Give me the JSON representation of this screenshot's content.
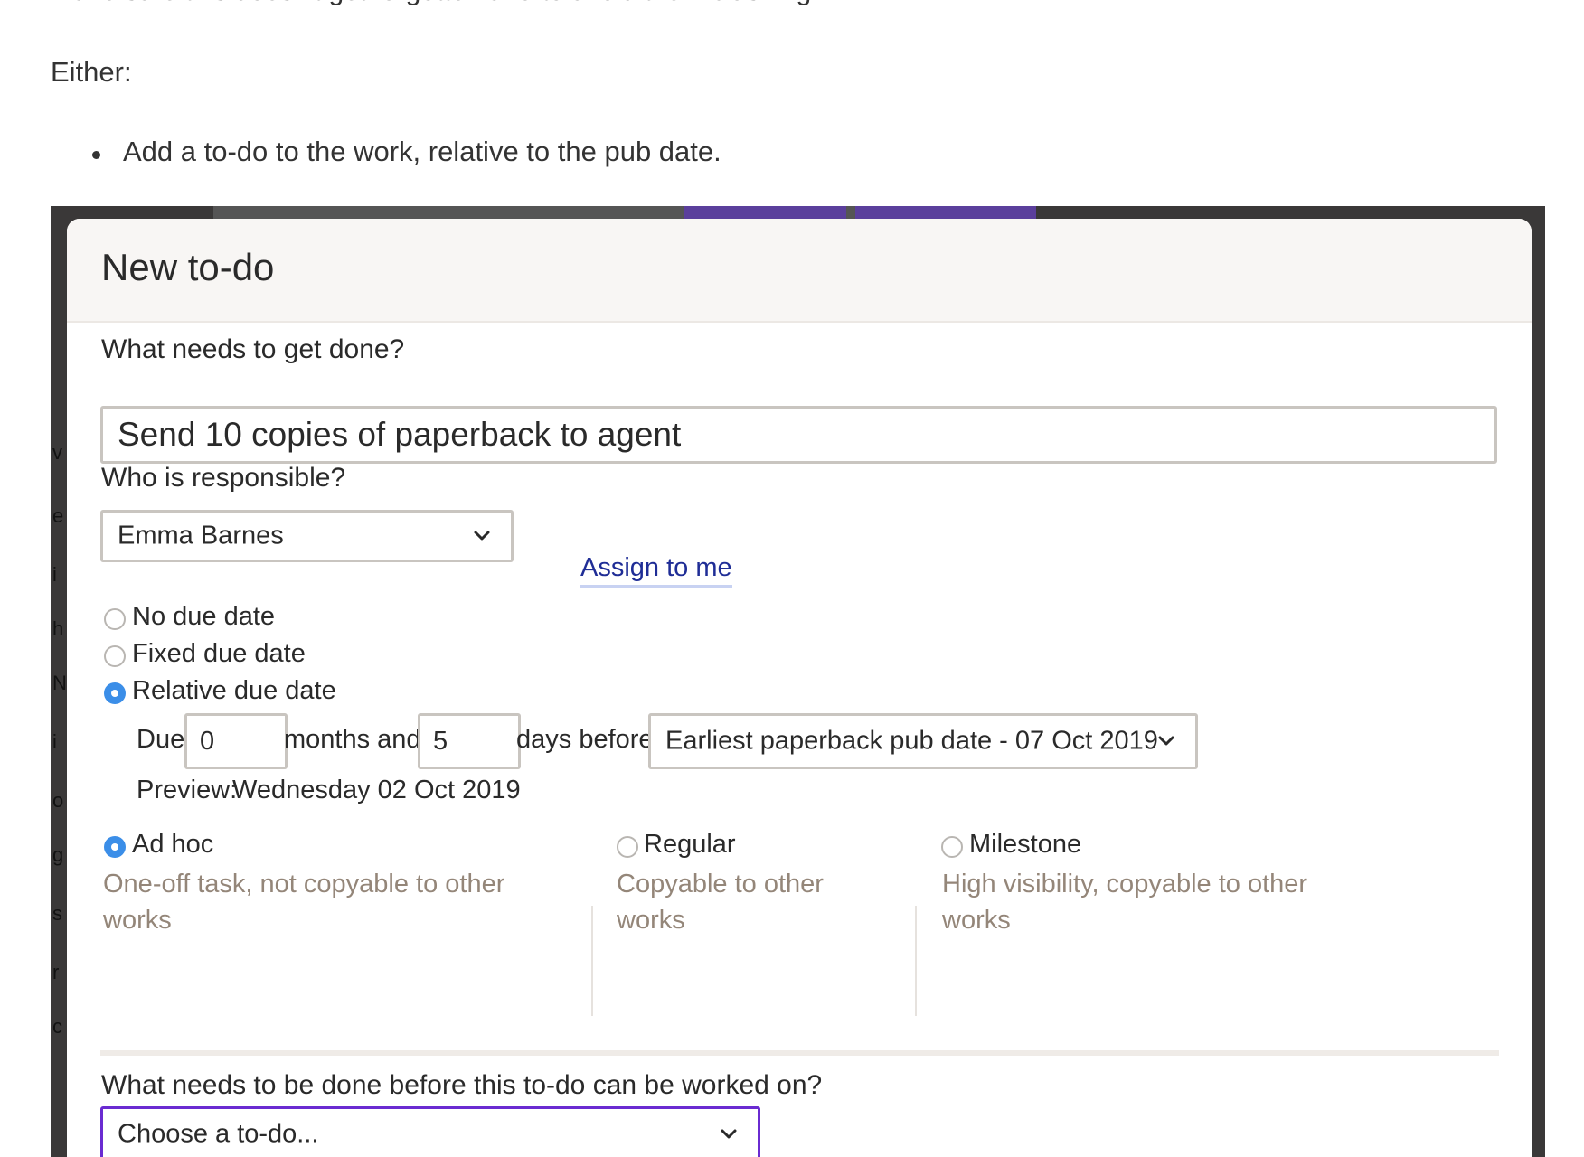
{
  "article": {
    "cut_text": "make sure this doesn't get forgotten and to avoid them clashing.",
    "either": "Either:",
    "bullets": [
      "Add a to-do to the work, relative to the pub date."
    ]
  },
  "modal": {
    "title": "New to-do",
    "task_question": "What needs to get done?",
    "task_value": "Send 10 copies of paperback to agent",
    "responsible_question": "Who is responsible?",
    "responsible_selected": "Emma Barnes",
    "assign_link": "Assign to me",
    "due_options": [
      {
        "label": "No due date",
        "selected": false
      },
      {
        "label": "Fixed due date",
        "selected": false
      },
      {
        "label": "Relative due date",
        "selected": true
      }
    ],
    "relative": {
      "due_label": "Due",
      "months_value": "0",
      "months_label": "months and",
      "days_value": "5",
      "days_label": "days before",
      "anchor_selected": "Earliest paperback pub date - 07 Oct 2019",
      "preview_label": "Preview:",
      "preview_value": "Wednesday 02 Oct 2019"
    },
    "types": [
      {
        "label": "Ad hoc",
        "selected": true,
        "desc": "One-off task, not copyable to other works"
      },
      {
        "label": "Regular",
        "selected": false,
        "desc": "Copyable to other works"
      },
      {
        "label": "Milestone",
        "selected": false,
        "desc": "High visibility, copyable to other works"
      }
    ],
    "dependency_question": "What needs to be done before this to-do can be worked on?",
    "dependency_placeholder": "Choose a to-do..."
  },
  "colors": {
    "accent_blue": "#3b8ee8",
    "link": "#1f2d96",
    "focus_purple": "#6a2bd1",
    "muted_text": "#948679"
  }
}
